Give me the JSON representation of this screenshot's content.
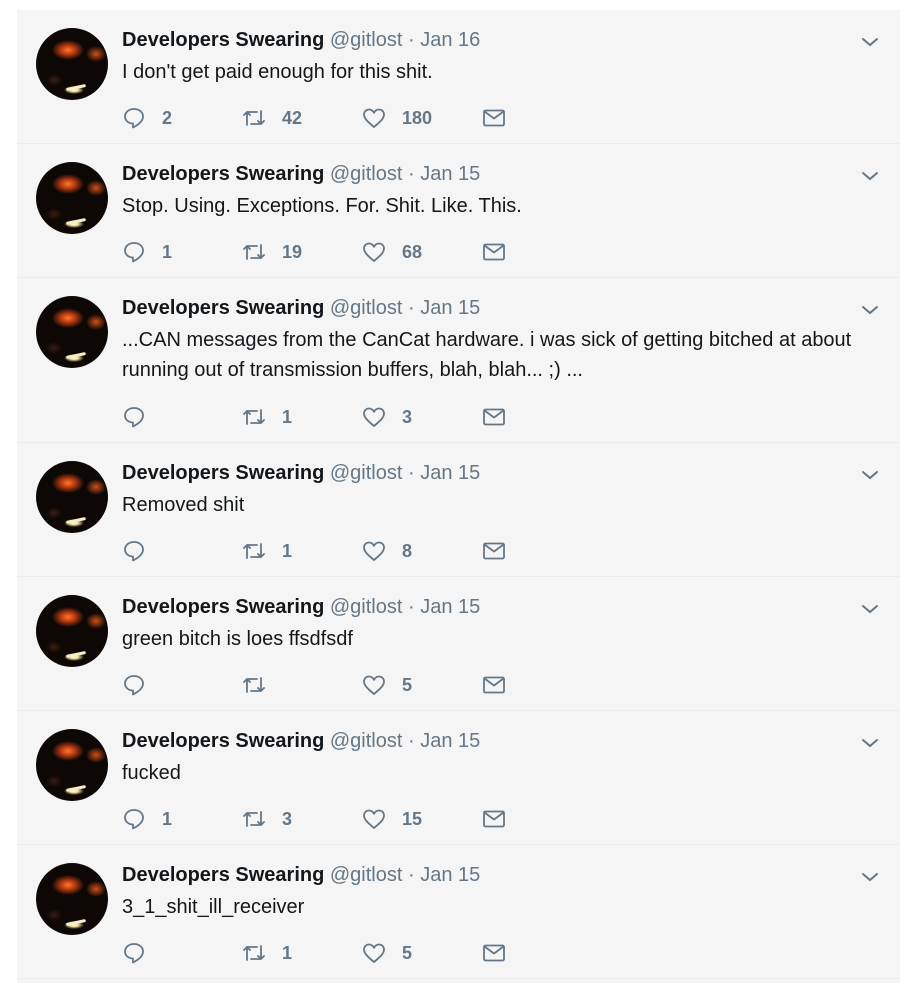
{
  "author": {
    "name": "Developers Swearing",
    "handle": "@gitlost",
    "separator": "·"
  },
  "tweets": [
    {
      "date": "Jan 16",
      "text": "I don't get paid enough for this shit.",
      "replies": "2",
      "retweets": "42",
      "likes": "180"
    },
    {
      "date": "Jan 15",
      "text": "Stop. Using. Exceptions. For. Shit. Like. This.",
      "replies": "1",
      "retweets": "19",
      "likes": "68"
    },
    {
      "date": "Jan 15",
      "text": "...CAN messages from the CanCat hardware.  i was sick of getting bitched at about running out of transmission buffers, blah, blah... ;) ...",
      "replies": "",
      "retweets": "1",
      "likes": "3"
    },
    {
      "date": "Jan 15",
      "text": "Removed shit",
      "replies": "",
      "retweets": "1",
      "likes": "8"
    },
    {
      "date": "Jan 15",
      "text": "green bitch is loes ffsdfsdf",
      "replies": "",
      "retweets": "",
      "likes": "5"
    },
    {
      "date": "Jan 15",
      "text": "fucked",
      "replies": "1",
      "retweets": "3",
      "likes": "15"
    },
    {
      "date": "Jan 15",
      "text": "3_1_shit_ill_receiver",
      "replies": "",
      "retweets": "1",
      "likes": "5"
    }
  ],
  "icons": {
    "reply": "reply-icon",
    "retweet": "retweet-icon",
    "like": "heart-icon",
    "message": "envelope-icon",
    "more": "chevron-down-icon"
  },
  "colors": {
    "feed_bg": "#f5f5f5",
    "name": "#14171a",
    "meta": "#657786"
  }
}
